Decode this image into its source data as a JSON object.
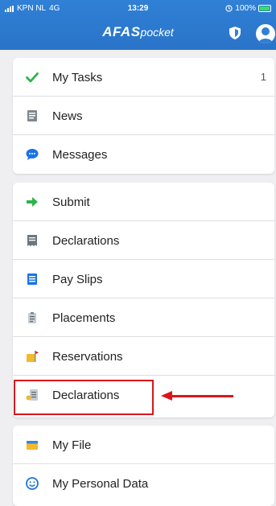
{
  "status_bar": {
    "carrier": "KPN NL",
    "network": "4G",
    "time": "13:29",
    "battery": "100%"
  },
  "header": {
    "app_name_bold": "AFAS",
    "app_name_light": "pocket",
    "icons": [
      "shield-icon",
      "avatar-icon"
    ]
  },
  "groups": [
    {
      "items": [
        {
          "label": "My Tasks",
          "icon": "check-icon",
          "badge": "1"
        },
        {
          "label": "News",
          "icon": "news-icon"
        },
        {
          "label": "Messages",
          "icon": "chat-bubble-icon"
        }
      ]
    },
    {
      "items": [
        {
          "label": "Submit",
          "icon": "arrow-right-icon"
        },
        {
          "label": "Declarations",
          "icon": "receipt-icon"
        },
        {
          "label": "Pay Slips",
          "icon": "document-icon"
        },
        {
          "label": "Placements",
          "icon": "clipboard-icon"
        },
        {
          "label": "Reservations",
          "icon": "flag-icon"
        },
        {
          "label": "Declarations",
          "icon": "declaration-form-icon"
        }
      ]
    },
    {
      "items": [
        {
          "label": "My File",
          "icon": "folder-icon"
        },
        {
          "label": "My Personal Data",
          "icon": "smiley-icon"
        }
      ]
    }
  ],
  "colors": {
    "header": "#2f80d6",
    "check": "#2db34a",
    "annotation": "#d9161c"
  }
}
